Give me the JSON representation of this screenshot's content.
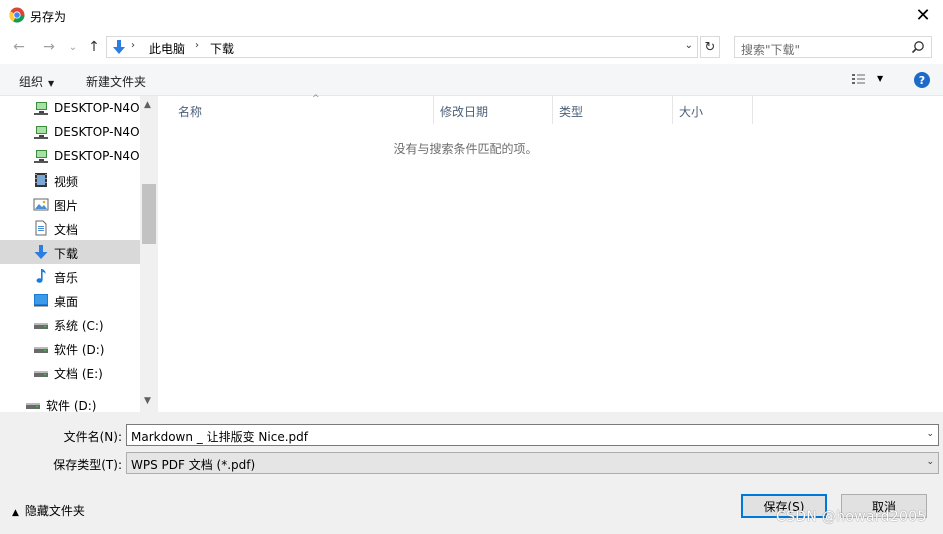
{
  "window": {
    "title": "另存为",
    "close_glyph": "✕"
  },
  "nav": {
    "back_glyph": "←",
    "forward_glyph": "→",
    "recent_glyph": "⌄",
    "up_glyph": "↑",
    "breadcrumb": [
      "此电脑",
      "下载"
    ],
    "sep_glyph": "›",
    "dropdown_glyph": "⌄",
    "refresh_glyph": "↻",
    "search_placeholder": "搜索\"下载\""
  },
  "toolbar": {
    "organize": "组织",
    "new_folder": "新建文件夹",
    "caret": "▼",
    "help": "?"
  },
  "sidebar": {
    "items": [
      {
        "label": "DESKTOP-N4O",
        "icon": "network-computer-icon"
      },
      {
        "label": "DESKTOP-N4O",
        "icon": "network-computer-icon"
      },
      {
        "label": "DESKTOP-N4O",
        "icon": "network-computer-icon"
      },
      {
        "label": "视频",
        "icon": "video-folder-icon"
      },
      {
        "label": "图片",
        "icon": "pictures-folder-icon"
      },
      {
        "label": "文档",
        "icon": "documents-folder-icon"
      },
      {
        "label": "下载",
        "icon": "download-folder-icon",
        "selected": true
      },
      {
        "label": "音乐",
        "icon": "music-folder-icon"
      },
      {
        "label": "桌面",
        "icon": "desktop-folder-icon"
      },
      {
        "label": "系统 (C:)",
        "icon": "drive-icon"
      },
      {
        "label": "软件 (D:)",
        "icon": "drive-icon"
      },
      {
        "label": "文档 (E:)",
        "icon": "drive-icon"
      },
      {
        "label": "软件 (D:)",
        "icon": "drive-icon"
      }
    ]
  },
  "columns": {
    "name": "名称",
    "modified": "修改日期",
    "type": "类型",
    "size": "大小",
    "sort_glyph": "^"
  },
  "filelist": {
    "empty_message": "没有与搜索条件匹配的项。"
  },
  "form": {
    "filename_label": "文件名(N):",
    "filename_value": "Markdown _ 让排版变 Nice.pdf",
    "filetype_label": "保存类型(T):",
    "filetype_value": "WPS PDF 文档 (*.pdf)"
  },
  "footer": {
    "hide_folders": "隐藏文件夹",
    "hide_caret": "▲",
    "save_button": "保存(S)",
    "cancel_button": "取消",
    "watermark": "CSDN @howard2005"
  },
  "colors": {
    "accent": "#0078d7",
    "selected_bg": "#d9d9d9",
    "help_blue": "#1c6ac9"
  }
}
